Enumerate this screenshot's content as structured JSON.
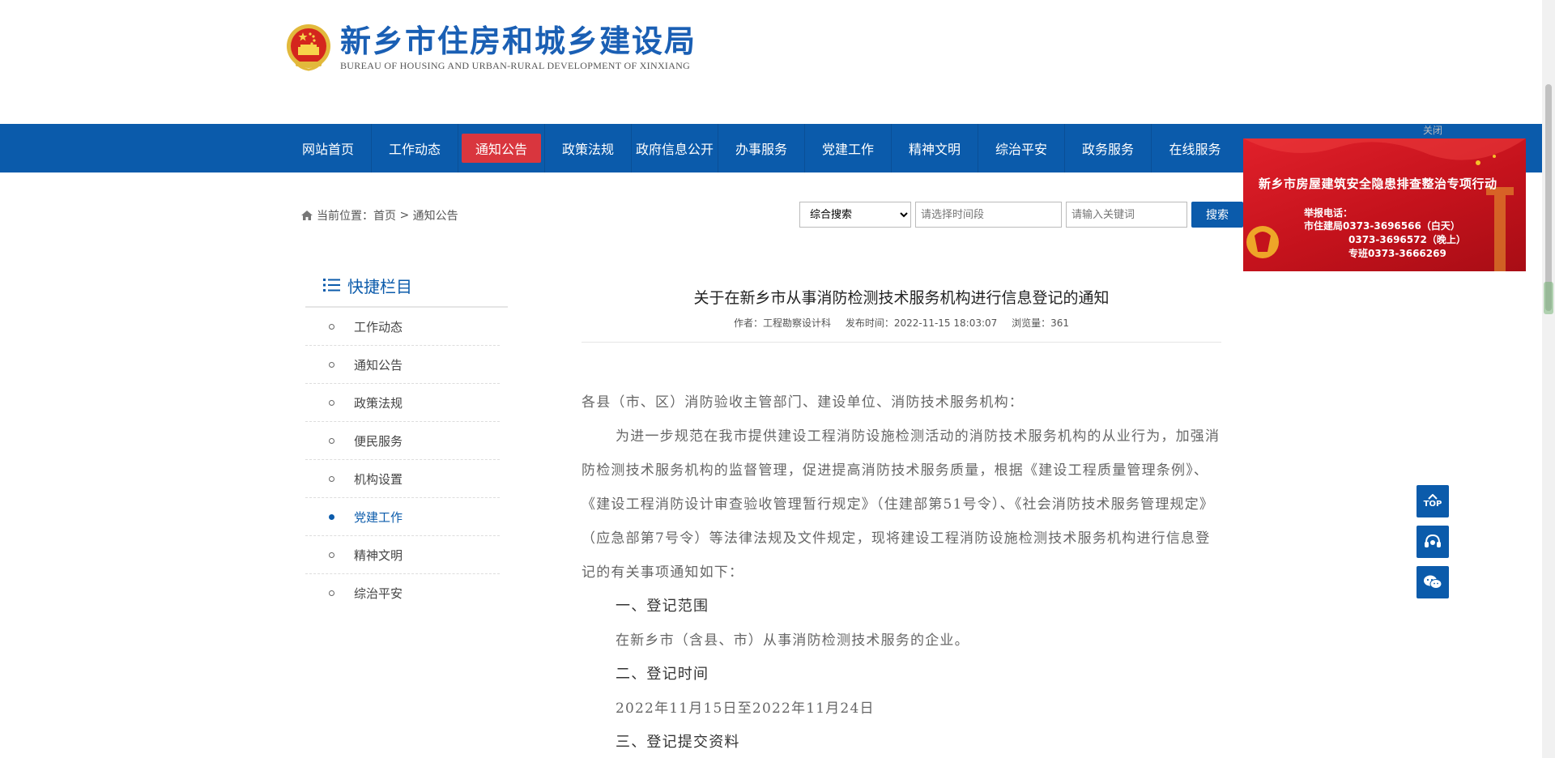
{
  "header": {
    "site_title": "新乡市住房和城乡建设局",
    "site_subtitle": "BUREAU  OF HOUSING AND URBAN-RURAL DEVELOPMENT OF XINXIANG"
  },
  "nav": {
    "items": [
      {
        "label": "网站首页"
      },
      {
        "label": "工作动态"
      },
      {
        "label": "通知公告"
      },
      {
        "label": "政策法规"
      },
      {
        "label": "政府信息公开"
      },
      {
        "label": "办事服务"
      },
      {
        "label": "党建工作"
      },
      {
        "label": "精神文明"
      },
      {
        "label": "综治平安"
      },
      {
        "label": "政务服务"
      },
      {
        "label": "在线服务"
      }
    ],
    "active_label": "通知公告"
  },
  "breadcrumb": {
    "prefix": "当前位置：",
    "home": "首页",
    "separator": " > ",
    "current": "通知公告"
  },
  "search": {
    "scope_selected": "综合搜索",
    "time_placeholder": "请选择时间段",
    "keyword_placeholder": "请输入关键词",
    "button_label": "搜索"
  },
  "sidebar": {
    "title": "快捷栏目",
    "items": [
      {
        "label": "工作动态"
      },
      {
        "label": "通知公告"
      },
      {
        "label": "政策法规"
      },
      {
        "label": "便民服务"
      },
      {
        "label": "机构设置"
      },
      {
        "label": "党建工作"
      },
      {
        "label": "精神文明"
      },
      {
        "label": "综治平安"
      }
    ],
    "active_label": "党建工作"
  },
  "article": {
    "title": "关于在新乡市从事消防检测技术服务机构进行信息登记的通知",
    "author": "作者：工程勘察设计科",
    "published": "发布时间：2022-11-15 18:03:07",
    "views": "浏览量：361",
    "salutation": "各县（市、区）消防验收主管部门、建设单位、消防技术服务机构：",
    "intro": "为进一步规范在我市提供建设工程消防设施检测活动的消防技术服务机构的从业行为，加强消防检测技术服务机构的监督管理，促进提高消防技术服务质量，根据《建设工程质量管理条例》、《建设工程消防设计审查验收管理暂行规定》（住建部第51号令）、《社会消防技术服务管理规定》（应急部第7号令）等法律法规及文件规定，现将建设工程消防设施检测技术服务机构进行信息登记的有关事项通知如下：",
    "section1_title": "一、登记范围",
    "section1_text": "在新乡市（含县、市）从事消防检测技术服务的企业。",
    "section2_title": "二、登记时间",
    "section2_text": "2022年11月15日至2022年11月24日",
    "section3_title": "三、登记提交资料"
  },
  "ad": {
    "close_label": "关闭",
    "title": "新乡市房屋建筑安全隐患排查整治专项行动",
    "line1": "举报电话：",
    "line2": "市住建局0373-3696566（白天）",
    "line3": "0373-3696572（晚上）",
    "line4": "专班0373-3666269"
  },
  "float_buttons": {
    "top_label": "TOP",
    "service_icon": "headset-icon",
    "wechat_icon": "wechat-icon"
  },
  "colors": {
    "brand_blue": "#0b5bab",
    "active_red": "#d9363e",
    "ad_red": "#c4121c"
  }
}
